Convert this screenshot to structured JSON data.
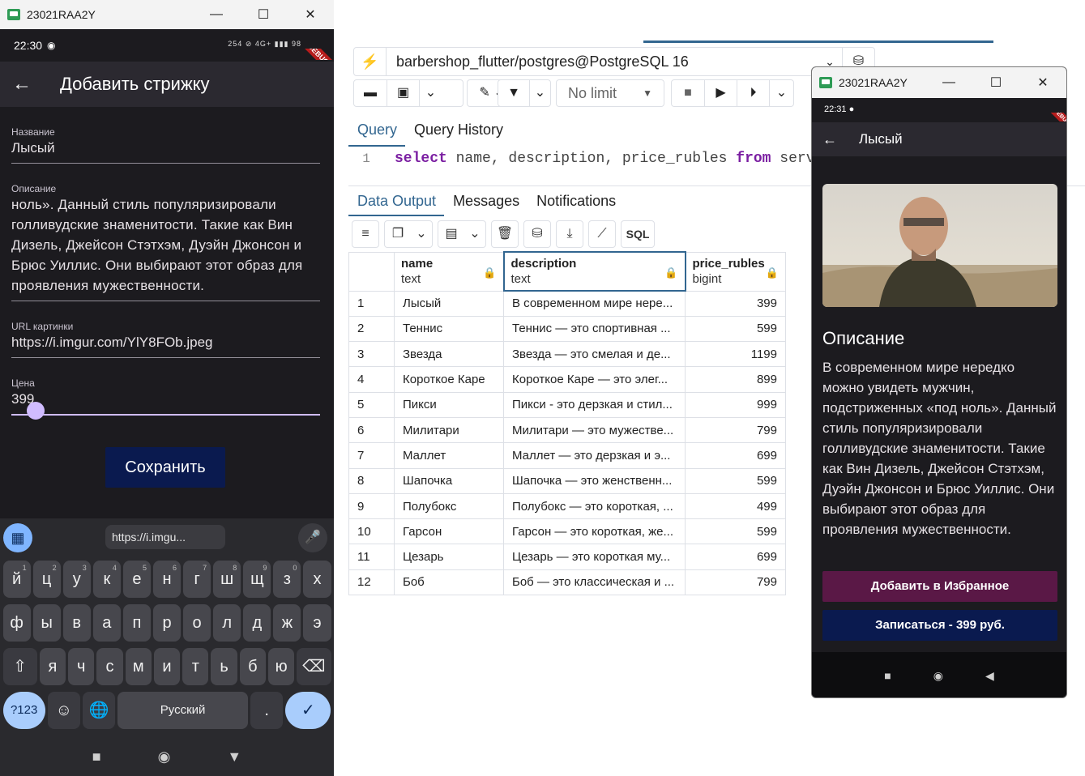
{
  "left_window": {
    "title": "23021RAA2Y",
    "controls": {
      "minimize": "—",
      "maximize": "☐",
      "close": "✕"
    },
    "status": {
      "time": "22:30",
      "icons": "254 ⊘ 4G+ ▮▮▮ 98"
    },
    "debug": "DEBUG",
    "app_bar": {
      "back": "←",
      "title": "Добавить стрижку"
    },
    "form": {
      "name_label": "Название",
      "name_value": "Лысый",
      "desc_label": "Описание",
      "desc_value": "ноль». Данный стиль популяризировали голливудские знаменитости. Такие как Вин Дизель, Джейсон Стэтхэм, Дуэйн Джонсон и Брюс Уиллис. Они выбирают этот образ для проявления мужественности.",
      "url_label": "URL картинки",
      "url_value": "https://i.imgur.com/YlY8FOb.jpeg",
      "price_label": "Цена",
      "price_value": "399",
      "save_label": "Сохранить"
    },
    "keyboard": {
      "apps_icon": "▦",
      "clipboard_chip": "https://i.imgu...",
      "mic_icon": "🎤",
      "row1": [
        {
          "k": "й",
          "n": "1"
        },
        {
          "k": "ц",
          "n": "2"
        },
        {
          "k": "у",
          "n": "3"
        },
        {
          "k": "к",
          "n": "4"
        },
        {
          "k": "е",
          "n": "5"
        },
        {
          "k": "н",
          "n": "6"
        },
        {
          "k": "г",
          "n": "7"
        },
        {
          "k": "ш",
          "n": "8"
        },
        {
          "k": "щ",
          "n": "9"
        },
        {
          "k": "з",
          "n": "0"
        },
        {
          "k": "х",
          "n": ""
        }
      ],
      "row2": [
        "ф",
        "ы",
        "в",
        "а",
        "п",
        "р",
        "о",
        "л",
        "д",
        "ж",
        "э"
      ],
      "row3": [
        "я",
        "ч",
        "с",
        "м",
        "и",
        "т",
        "ь",
        "б",
        "ю"
      ],
      "shift_icon": "⇧",
      "backspace_icon": "⌫",
      "sym_label": "?123",
      "emoji_icon": "☺",
      "globe_icon": "🌐",
      "space_label": "Русский",
      "period_label": ".",
      "enter_icon": "✓"
    },
    "nav": {
      "square": "■",
      "circle": "◉",
      "back": "▼"
    }
  },
  "pgadmin": {
    "connection": "barbershop_flutter/postgres@PostgreSQL 16",
    "no_limit": "No limit",
    "tabs": [
      "Query",
      "Query History"
    ],
    "line_number": "1",
    "query_tokens": {
      "select": "select",
      "cols": " name, description, price_rubles ",
      "from": "from",
      "rest": " serv"
    },
    "output_tabs": [
      "Data Output",
      "Messages",
      "Notifications"
    ],
    "sql_button": "SQL",
    "columns": [
      {
        "name": "name",
        "type": "text"
      },
      {
        "name": "description",
        "type": "text"
      },
      {
        "name": "price_rubles",
        "type": "bigint"
      }
    ],
    "rows": [
      [
        "1",
        "Лысый",
        "В современном мире нере...",
        "399"
      ],
      [
        "2",
        "Теннис",
        "Теннис — это спортивная ...",
        "599"
      ],
      [
        "3",
        "Звезда",
        "Звезда — это смелая и де...",
        "1199"
      ],
      [
        "4",
        "Короткое Каре",
        "Короткое Каре — это элег...",
        "899"
      ],
      [
        "5",
        "Пикси",
        "Пикси - это дерзкая и стил...",
        "999"
      ],
      [
        "6",
        "Милитари",
        "Милитари — это мужестве...",
        "799"
      ],
      [
        "7",
        "Маллет",
        "Маллет — это дерзкая и э...",
        "699"
      ],
      [
        "8",
        "Шапочка",
        "Шапочка — это женственн...",
        "599"
      ],
      [
        "9",
        "Полубокс",
        "Полубокс — это короткая, ...",
        "499"
      ],
      [
        "10",
        "Гарсон",
        "Гарсон — это короткая, же...",
        "599"
      ],
      [
        "11",
        "Цезарь",
        "Цезарь — это короткая му...",
        "699"
      ],
      [
        "12",
        "Боб",
        "Боб — это классическая и ...",
        "799"
      ]
    ]
  },
  "right_window": {
    "title": "23021RAA2Y",
    "controls": {
      "minimize": "—",
      "maximize": "☐",
      "close": "✕"
    },
    "status": {
      "time": "22:31 ●"
    },
    "debug": "DEBUG",
    "app_bar": {
      "back": "←",
      "title": "Лысый"
    },
    "heading": "Описание",
    "description": "В современном мире нередко можно увидеть мужчин, подстриженных «под ноль». Данный стиль популяризировали голливудские знаменитости. Такие как Вин Дизель, Джейсон Стэтхэм, Дуэйн Джонсон и Брюс Уиллис. Они выбирают этот образ для проявления мужественности.",
    "favorite_label": "Добавить в Избранное",
    "book_label": "Записаться - 399 руб.",
    "nav": {
      "square": "■",
      "circle": "◉",
      "back": "◀"
    }
  }
}
